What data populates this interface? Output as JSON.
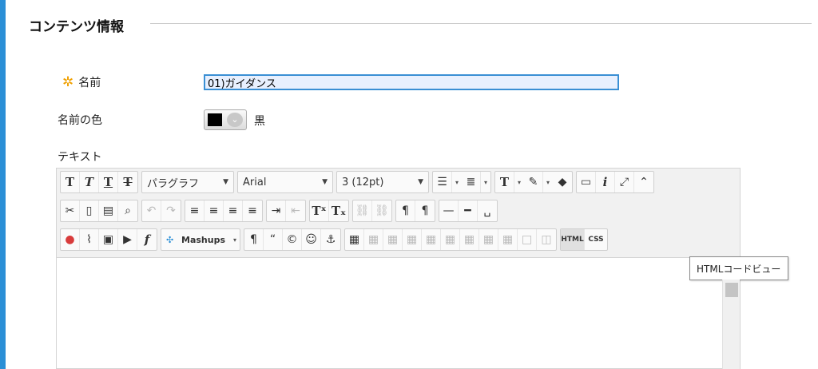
{
  "section": {
    "title": "コンテンツ情報"
  },
  "form": {
    "name_label": "名前",
    "name_value": "01)ガイダンス",
    "color_label": "名前の色",
    "color_value": "黒",
    "color_hex": "#000000",
    "text_label": "テキスト"
  },
  "toolbar": {
    "format_select": "パラグラフ",
    "font_select": "Arial",
    "size_select": "3 (12pt)",
    "mashups_label": "Mashups",
    "html_label": "HTML",
    "css_label": "CSS",
    "tooltip": "HTMLコードビュー"
  },
  "colors": {
    "accent": "#2b8fd6",
    "input_border": "#3a8fd4",
    "required_star": "#f0a000"
  }
}
